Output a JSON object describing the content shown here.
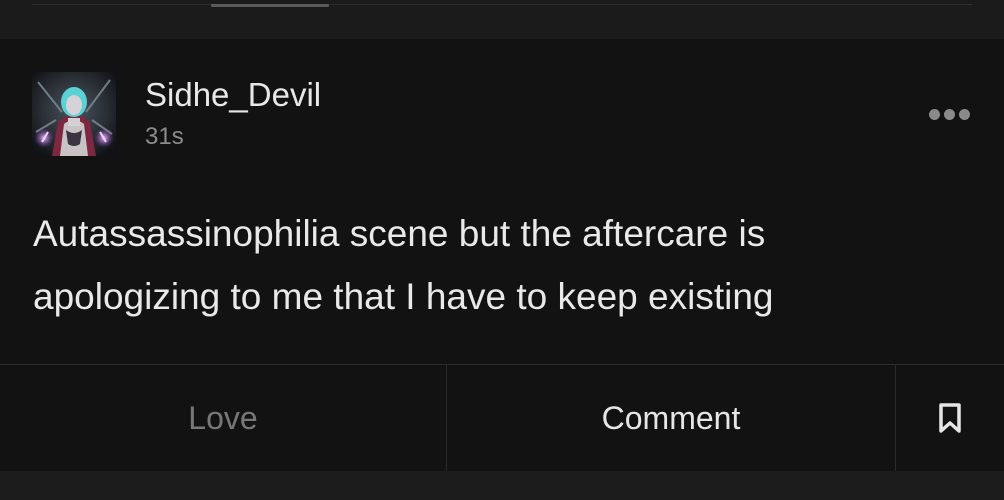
{
  "post": {
    "author": {
      "username": "Sidhe_Devil",
      "avatar_icon": "avatar-image"
    },
    "timestamp": "31s",
    "more_icon": "more-options-icon",
    "text_lines": [
      "Autassassinophilia scene but the aftercare is",
      "apologizing to me that I have to keep existing"
    ],
    "actions": {
      "love_label": "Love",
      "comment_label": "Comment",
      "save_icon": "bookmark-icon"
    }
  },
  "colors": {
    "background": "#121212",
    "surround": "#1c1c1c",
    "text_primary": "#e6e6e6",
    "text_muted": "#8c8c8c",
    "love_inactive": "#777777"
  }
}
